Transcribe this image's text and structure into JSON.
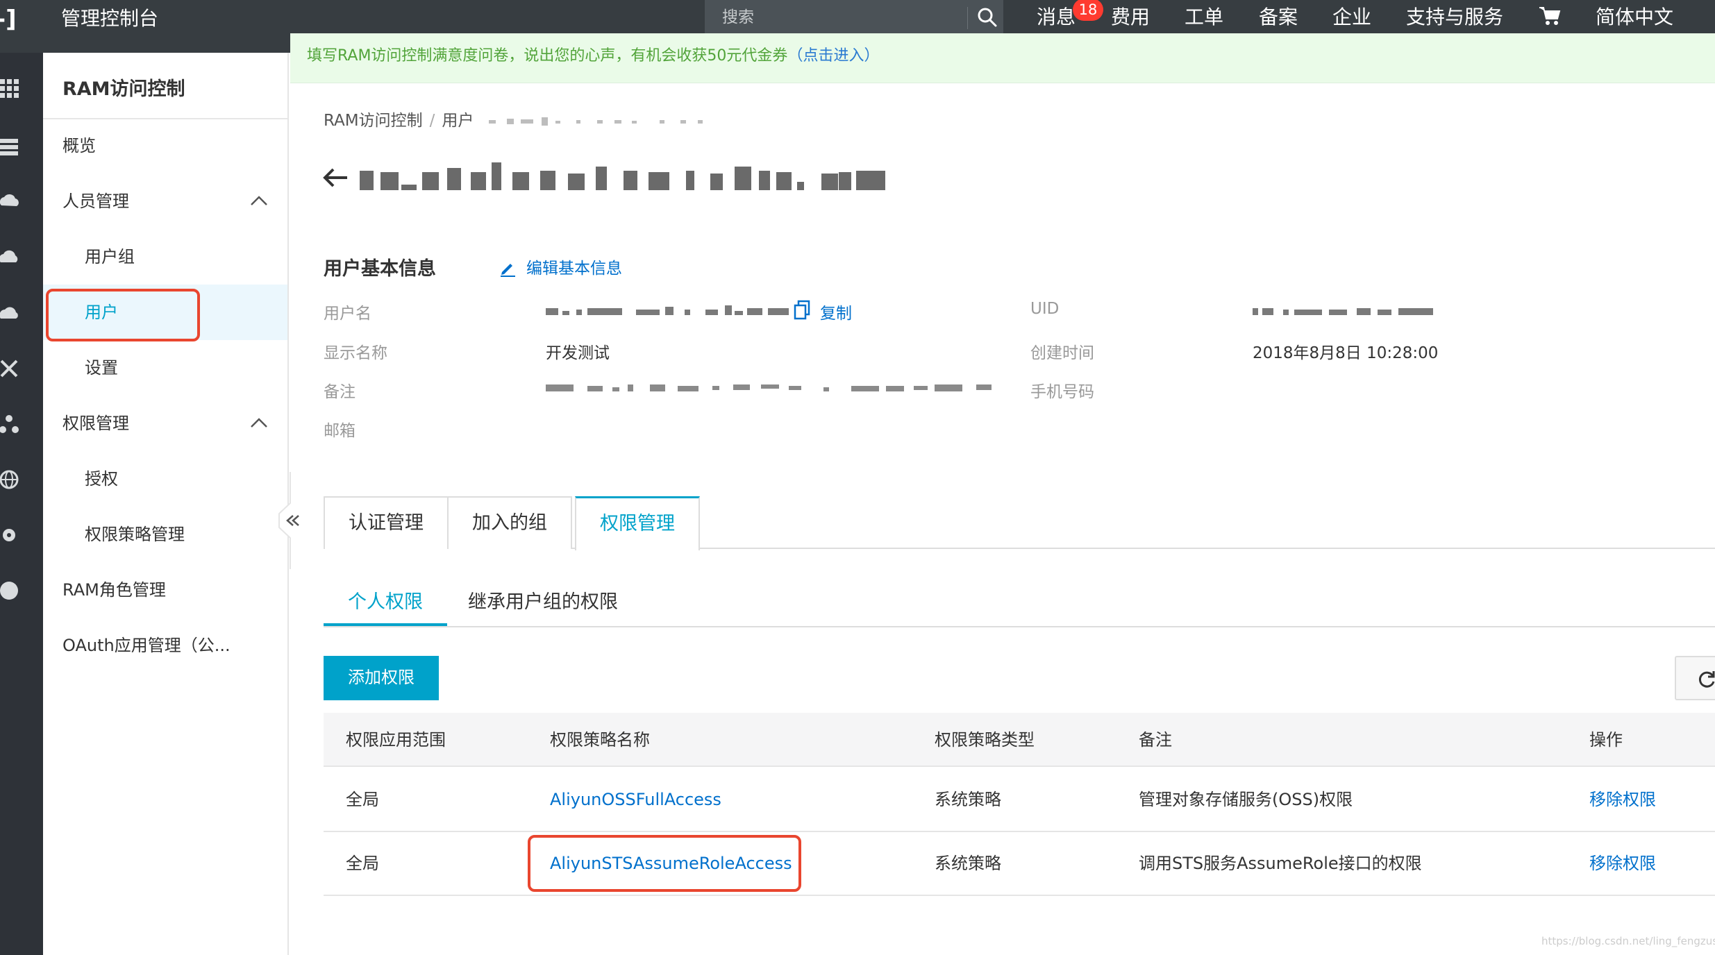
{
  "topbar": {
    "logo_glyph": "-]",
    "console_title": "管理控制台",
    "search_placeholder": "搜索",
    "search_icon": "search-icon",
    "nav": [
      "消息",
      "费用",
      "工单",
      "备案",
      "企业",
      "支持与服务",
      "简体中文"
    ],
    "message_badge": "18",
    "cart_icon": "cart-icon"
  },
  "iconbar": {
    "icons": [
      "grid-icon",
      "list-icon",
      "cloud-server-icon",
      "cloud-icon",
      "cloud-alt-icon",
      "network-icon",
      "nodes-icon",
      "globe-icon",
      "settings-icon",
      "circle-icon"
    ]
  },
  "sidebar": {
    "title": "RAM访问控制",
    "items": [
      {
        "label": "概览"
      },
      {
        "label": "人员管理",
        "expanded": true
      },
      {
        "label": "用户组"
      },
      {
        "label": "用户",
        "active": true
      },
      {
        "label": "设置"
      },
      {
        "label": "权限管理",
        "expanded": true
      },
      {
        "label": "授权"
      },
      {
        "label": "权限策略管理"
      },
      {
        "label": "RAM角色管理"
      },
      {
        "label": "OAuth应用管理（公..."
      }
    ],
    "collapse_icon": "double-chevron-left-icon"
  },
  "banner": {
    "text": "填写RAM访问控制满意度问卷，说出您的心声，有机会收获50元代金券",
    "link": "（点击进入）"
  },
  "breadcrumb": {
    "items": [
      "RAM访问控制",
      "用户"
    ]
  },
  "basic_info": {
    "title": "用户基本信息",
    "edit_label": "编辑基本信息",
    "fields": {
      "username_label": "用户名",
      "copy_label": "复制",
      "display_name_label": "显示名称",
      "display_name_value": "开发测试",
      "note_label": "备注",
      "email_label": "邮箱",
      "uid_label": "UID",
      "created_label": "创建时间",
      "created_value": "2018年8月8日 10:28:00",
      "phone_label": "手机号码"
    }
  },
  "tabs": [
    "认证管理",
    "加入的组",
    "权限管理"
  ],
  "active_tab": "权限管理",
  "subtabs": [
    "个人权限",
    "继承用户组的权限"
  ],
  "active_subtab": "个人权限",
  "add_button": "添加权限",
  "table": {
    "headers": [
      "权限应用范围",
      "权限策略名称",
      "权限策略类型",
      "备注",
      "操作"
    ],
    "rows": [
      [
        "全局",
        "AliyunOSSFullAccess",
        "系统策略",
        "管理对象存储服务(OSS)权限",
        "移除权限"
      ],
      [
        "全局",
        "AliyunSTSAssumeRoleAccess",
        "系统策略",
        "调用STS服务AssumeRole接口的权限",
        "移除权限"
      ]
    ]
  },
  "colors": {
    "topbar": "#373d41",
    "accent": "#00a2ca",
    "link": "#0070cc",
    "highlight_outline": "#e9462f",
    "banner_bg": "#eafbe8"
  },
  "watermark": "https://blog.csdn.net/ling_fengzus"
}
